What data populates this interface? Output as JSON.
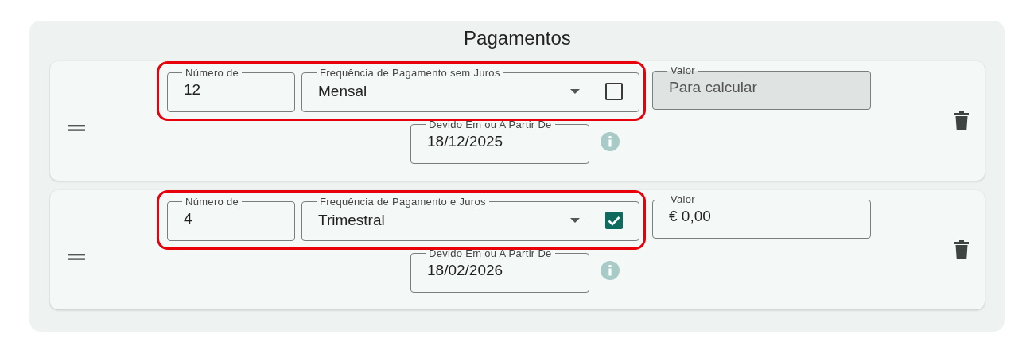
{
  "title": "Pagamentos",
  "payments": [
    {
      "highlighted": true,
      "count": {
        "label": "Número de",
        "value": "12"
      },
      "frequency": {
        "label": "Frequência de Pagamento sem Juros",
        "value": "Mensal",
        "interest": false
      },
      "amount": {
        "label": "Valor",
        "value": "Para calcular",
        "disabled": true
      },
      "due": {
        "label": "Devido Em ou A Partir De",
        "value": "18/12/2025"
      }
    },
    {
      "highlighted": true,
      "count": {
        "label": "Número de",
        "value": "4"
      },
      "frequency": {
        "label": "Frequência de Pagamento e Juros",
        "value": "Trimestral",
        "interest": true
      },
      "amount": {
        "label": "Valor",
        "value": "€ 0,00",
        "disabled": false
      },
      "due": {
        "label": "Devido Em ou A Partir De",
        "value": "18/02/2026"
      }
    }
  ]
}
